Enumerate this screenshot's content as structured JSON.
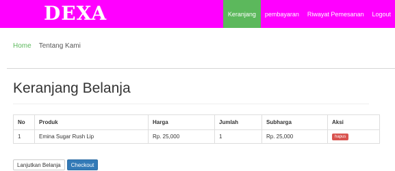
{
  "navbar": {
    "brand": "DEXA",
    "links": [
      {
        "label": "Keranjang",
        "active": true
      },
      {
        "label": "pembayaran",
        "active": false
      },
      {
        "label": "Riwayat Pemesanan",
        "active": false
      },
      {
        "label": "Logout",
        "active": false
      }
    ]
  },
  "breadcrumb": [
    "Home",
    "Tentang Kami"
  ],
  "page": {
    "title": "Keranjang Belanja"
  },
  "table": {
    "headers": [
      "No",
      "Produk",
      "Harga",
      "Jumlah",
      "Subharga",
      "Aksi"
    ],
    "rows": [
      {
        "no": "1",
        "produk": "Emina Sugar Rush Lip",
        "harga": "Rp. 25,000",
        "jumlah": "1",
        "subharga": "Rp. 25,000",
        "aksi": "hapus"
      }
    ]
  },
  "buttons": {
    "continue": "Lanjutkan Belanja",
    "checkout": "Checkout"
  },
  "colors": {
    "navbar": "#ff00ff",
    "active": "#5cb85c",
    "primary": "#337ab7",
    "danger": "#d9534f"
  }
}
